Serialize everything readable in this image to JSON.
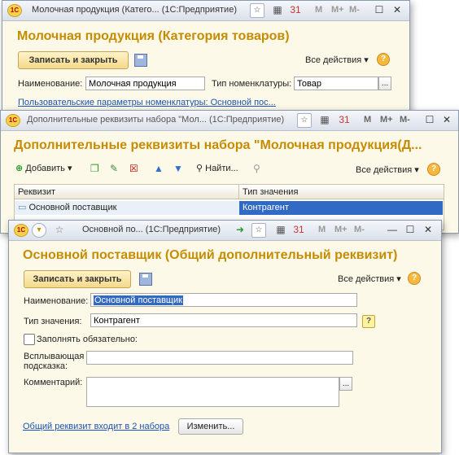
{
  "colors": {
    "accent": "#c58c00",
    "selection": "#316ac5",
    "link": "#1a52b5",
    "window_bg": "#fdf9e8"
  },
  "window1": {
    "title": "Молочная продукция (Катего... (1С:Предприятие)",
    "heading": "Молочная продукция (Категория товаров)",
    "save_close": "Записать и закрыть",
    "all_actions": "Все действия",
    "name_label": "Наименование:",
    "name_value": "Молочная продукция",
    "type_label": "Тип номенклатуры:",
    "type_value": "Товар",
    "dots": "...",
    "user_params_link": "Пользовательские параметры номенклатуры: Основной пос..."
  },
  "window2": {
    "title": "Дополнительные реквизиты набора \"Мол... (1С:Предприятие)",
    "heading": "Дополнительные реквизиты набора \"Молочная продукция(Д...",
    "add": "Добавить",
    "find": "Найти...",
    "all_actions": "Все действия",
    "columns": [
      "Реквизит",
      "Тип значения"
    ],
    "rows": [
      {
        "rekvizit": "Основной поставщик",
        "type": "Контрагент"
      }
    ]
  },
  "window3": {
    "title": "Основной по... (1С:Предприятие)",
    "heading": "Основной поставщик (Общий дополнительный реквизит)",
    "save_close": "Записать и закрыть",
    "all_actions": "Все действия",
    "name_label": "Наименование:",
    "name_value": "Основной поставщик",
    "type_label": "Тип значения:",
    "type_value": "Контрагент",
    "type_help": "?",
    "required_label": "Заполнять обязательно:",
    "tooltip_label_1": "Всплывающая",
    "tooltip_label_2": "подсказка:",
    "comment_label": "Комментарий:",
    "dots": "...",
    "sets_link": "Общий реквизит входит в 2 набора",
    "change_button": "Изменить..."
  },
  "toolbar_labels": {
    "m": "M",
    "mplus": "M+",
    "mminus": "M-",
    "cal": "31"
  },
  "icons": [
    "1c-logo-icon",
    "star-icon",
    "calculator-icon",
    "calendar-icon",
    "minimize-icon",
    "maximize-icon",
    "close-icon",
    "save-icon",
    "help-icon",
    "add-icon",
    "copy-icon",
    "edit-icon",
    "delete-icon",
    "up-arrow-icon",
    "down-arrow-icon",
    "search-icon",
    "back-icon",
    "forward-icon"
  ]
}
